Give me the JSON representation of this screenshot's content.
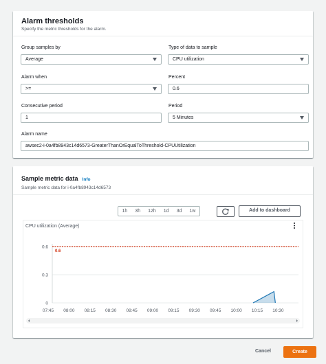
{
  "alarm_thresholds": {
    "title": "Alarm thresholds",
    "subtitle": "Specify the metric thresholds for the alarm.",
    "group_samples": {
      "label": "Group samples by",
      "value": "Average"
    },
    "data_type": {
      "label": "Type of data to sample",
      "value": "CPU utilization"
    },
    "alarm_when": {
      "label": "Alarm when",
      "value": ">="
    },
    "percent": {
      "label": "Percent",
      "value": "0.6"
    },
    "consecutive": {
      "label": "Consecutive period",
      "value": "1"
    },
    "period": {
      "label": "Period",
      "value": "5 Minutes"
    },
    "alarm_name": {
      "label": "Alarm name",
      "value": "awsec2-i-0a4fb8943c14d6573-GreaterThanOrEqualToThreshold-CPUUtilization"
    }
  },
  "sample_metric": {
    "title": "Sample metric data",
    "info": "Info",
    "subtitle": "Sample metric data for i-0a4fb8943c14d6573",
    "ranges": [
      "1h",
      "3h",
      "12h",
      "1d",
      "3d",
      "1w"
    ],
    "refresh_icon": "refresh-icon",
    "add_to_dashboard": "Add to dashboard",
    "more_icon": "vertical-ellipsis-icon"
  },
  "chart_data": {
    "type": "line",
    "title": "CPU utilization (Average)",
    "x": [
      "07:45",
      "08:00",
      "08:15",
      "08:30",
      "08:45",
      "09:00",
      "09:15",
      "09:30",
      "09:45",
      "10:00",
      "10:15",
      "10:30"
    ],
    "ylim": [
      0,
      0.6
    ],
    "yticks": [
      "0",
      "0.3",
      "0.6"
    ],
    "threshold": {
      "value": 0.6,
      "label": "0.6",
      "color": "#d13212"
    },
    "series": [
      {
        "color": "#1f77b4",
        "points": [
          [
            10.12,
            0
          ],
          [
            10.27,
            0.12
          ],
          [
            10.28,
            0
          ]
        ]
      }
    ],
    "grid": true
  },
  "footer": {
    "cancel": "Cancel",
    "create": "Create"
  },
  "colors": {
    "accent": "#ec7211",
    "link": "#0073bb",
    "threshold": "#d13212",
    "series": "#1f77b4"
  }
}
